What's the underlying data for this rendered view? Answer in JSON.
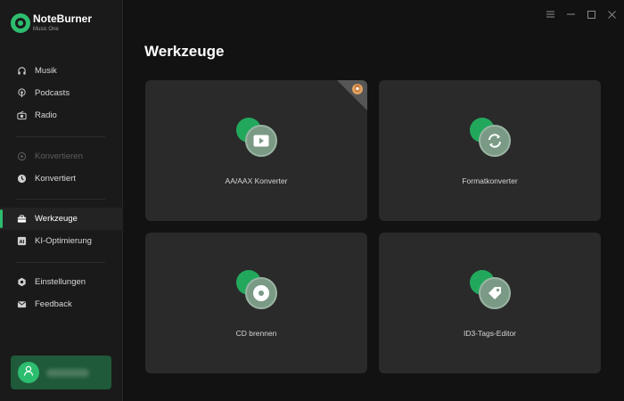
{
  "brand": {
    "name": "NoteBurner",
    "subtitle": "Music One"
  },
  "sidebar": {
    "groups": [
      [
        {
          "label": "Musik",
          "icon": "headphones-icon"
        },
        {
          "label": "Podcasts",
          "icon": "podcast-icon"
        },
        {
          "label": "Radio",
          "icon": "radio-icon"
        }
      ],
      [
        {
          "label": "Konvertieren",
          "icon": "convert-icon",
          "disabled": true
        },
        {
          "label": "Konvertiert",
          "icon": "clock-icon"
        }
      ],
      [
        {
          "label": "Werkzeuge",
          "icon": "toolbox-icon",
          "active": true
        },
        {
          "label": "KI-Optimierung",
          "icon": "ai-icon"
        }
      ],
      [
        {
          "label": "Einstellungen",
          "icon": "gear-icon"
        },
        {
          "label": "Feedback",
          "icon": "mail-icon"
        }
      ]
    ]
  },
  "user": {
    "avatar_icon": "user-icon"
  },
  "main": {
    "title": "Werkzeuge",
    "tools": [
      {
        "label": "AA/AAX Konverter",
        "icon": "play-icon",
        "badge": "new-badge-icon"
      },
      {
        "label": "Formatkonverter",
        "icon": "refresh-icon"
      },
      {
        "label": "CD brennen",
        "icon": "disc-icon"
      },
      {
        "label": "ID3-Tags-Editor",
        "icon": "tag-icon"
      }
    ]
  },
  "colors": {
    "accent": "#2dbd6e",
    "card": "#2a2a2a",
    "background": "#121212",
    "sidebar": "#1a1a1a"
  }
}
